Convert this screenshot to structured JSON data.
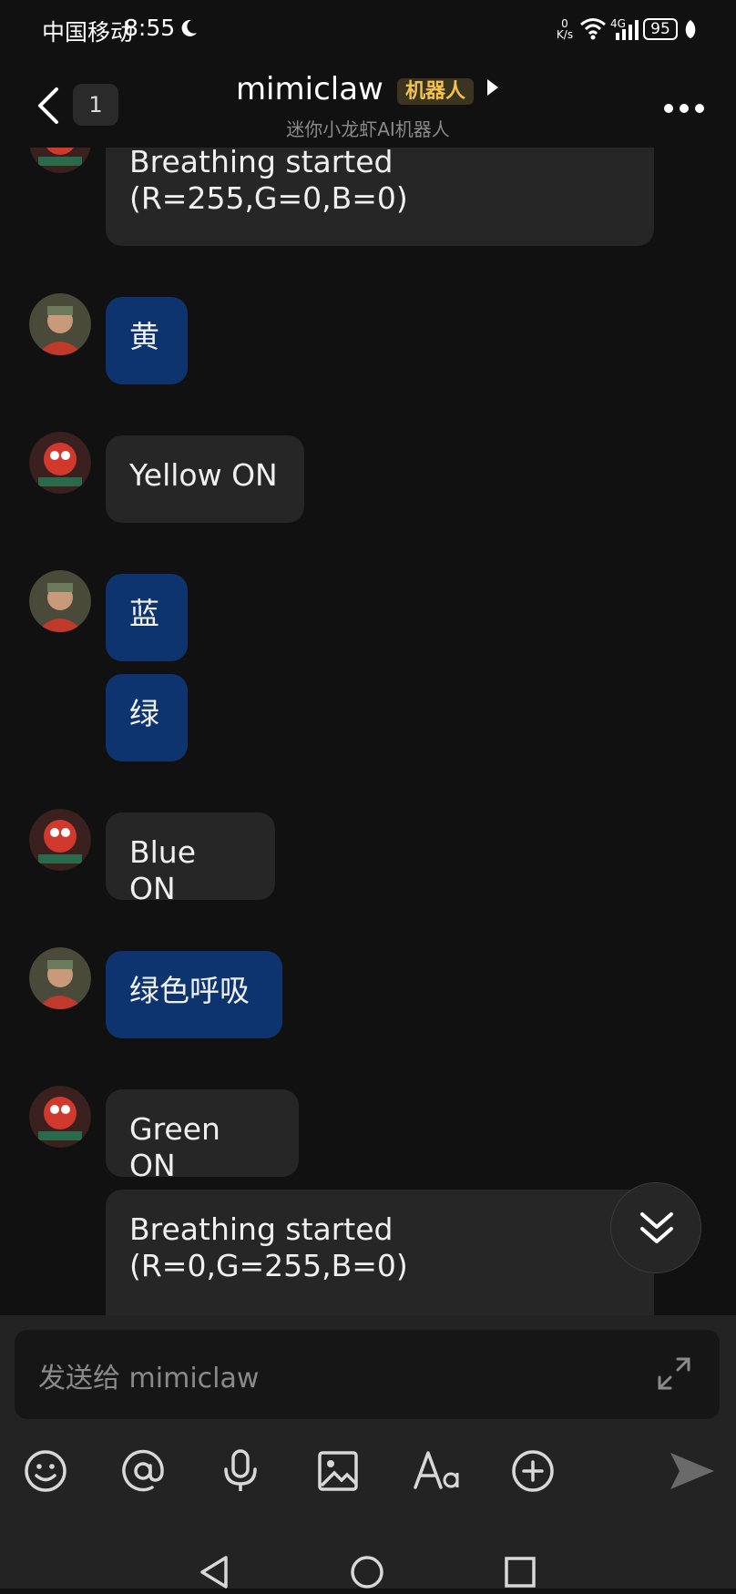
{
  "status_bar": {
    "carrier": "中国移动",
    "time": "8:55",
    "net_speed_value": "0",
    "net_speed_unit": "K/s",
    "network_type": "4G",
    "battery": "95"
  },
  "header": {
    "unread_count": "1",
    "chat_name": "mimiclaw",
    "robot_tag": "机器人",
    "subtitle": "迷你小龙虾AI机器人"
  },
  "messages": [
    {
      "sender": "bot",
      "lines": [
        "Breathing started",
        "(R=255,G=0,B=0)"
      ]
    },
    {
      "sender": "user",
      "text": "黄"
    },
    {
      "sender": "bot",
      "text": "Yellow ON"
    },
    {
      "sender": "user",
      "text": "蓝"
    },
    {
      "sender": "user",
      "text": "绿"
    },
    {
      "sender": "bot",
      "text": "Blue ON"
    },
    {
      "sender": "user",
      "text": "绿色呼吸"
    },
    {
      "sender": "bot",
      "text": "Green ON"
    },
    {
      "sender": "bot",
      "lines": [
        "Breathing started",
        "(R=0,G=255,B=0)"
      ]
    }
  ],
  "input": {
    "placeholder": "发送给 mimiclaw"
  },
  "toolbar": {
    "icons": [
      "emoji-icon",
      "at-icon",
      "microphone-icon",
      "image-icon",
      "text-format-icon",
      "plus-icon",
      "send-icon"
    ]
  },
  "colors": {
    "background": "#111111",
    "bot_bubble": "#262626",
    "user_bubble": "#0e3470",
    "robot_tag_text": "#f2c24a"
  }
}
